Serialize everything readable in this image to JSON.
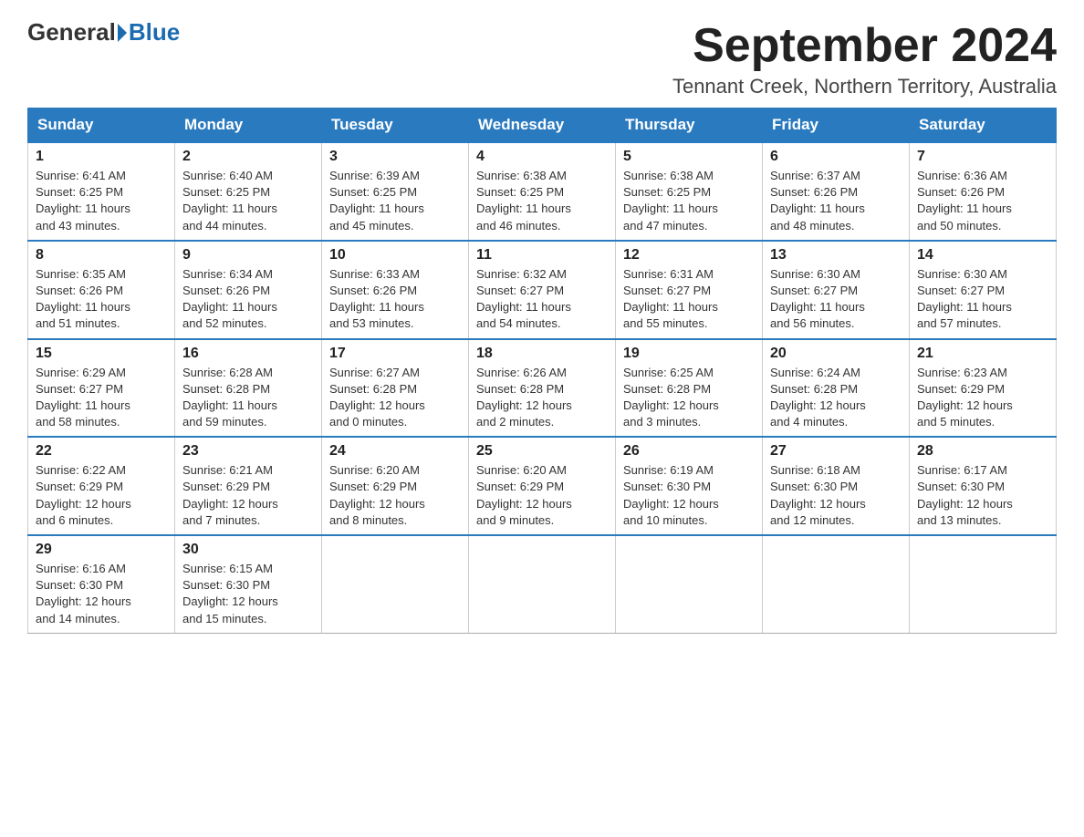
{
  "header": {
    "logo": {
      "general": "General",
      "blue": "Blue",
      "alt": "GeneralBlue logo"
    },
    "title": "September 2024",
    "subtitle": "Tennant Creek, Northern Territory, Australia"
  },
  "days_of_week": [
    "Sunday",
    "Monday",
    "Tuesday",
    "Wednesday",
    "Thursday",
    "Friday",
    "Saturday"
  ],
  "weeks": [
    [
      {
        "day": "1",
        "sunrise": "6:41 AM",
        "sunset": "6:25 PM",
        "daylight": "11 hours and 43 minutes."
      },
      {
        "day": "2",
        "sunrise": "6:40 AM",
        "sunset": "6:25 PM",
        "daylight": "11 hours and 44 minutes."
      },
      {
        "day": "3",
        "sunrise": "6:39 AM",
        "sunset": "6:25 PM",
        "daylight": "11 hours and 45 minutes."
      },
      {
        "day": "4",
        "sunrise": "6:38 AM",
        "sunset": "6:25 PM",
        "daylight": "11 hours and 46 minutes."
      },
      {
        "day": "5",
        "sunrise": "6:38 AM",
        "sunset": "6:25 PM",
        "daylight": "11 hours and 47 minutes."
      },
      {
        "day": "6",
        "sunrise": "6:37 AM",
        "sunset": "6:26 PM",
        "daylight": "11 hours and 48 minutes."
      },
      {
        "day": "7",
        "sunrise": "6:36 AM",
        "sunset": "6:26 PM",
        "daylight": "11 hours and 50 minutes."
      }
    ],
    [
      {
        "day": "8",
        "sunrise": "6:35 AM",
        "sunset": "6:26 PM",
        "daylight": "11 hours and 51 minutes."
      },
      {
        "day": "9",
        "sunrise": "6:34 AM",
        "sunset": "6:26 PM",
        "daylight": "11 hours and 52 minutes."
      },
      {
        "day": "10",
        "sunrise": "6:33 AM",
        "sunset": "6:26 PM",
        "daylight": "11 hours and 53 minutes."
      },
      {
        "day": "11",
        "sunrise": "6:32 AM",
        "sunset": "6:27 PM",
        "daylight": "11 hours and 54 minutes."
      },
      {
        "day": "12",
        "sunrise": "6:31 AM",
        "sunset": "6:27 PM",
        "daylight": "11 hours and 55 minutes."
      },
      {
        "day": "13",
        "sunrise": "6:30 AM",
        "sunset": "6:27 PM",
        "daylight": "11 hours and 56 minutes."
      },
      {
        "day": "14",
        "sunrise": "6:30 AM",
        "sunset": "6:27 PM",
        "daylight": "11 hours and 57 minutes."
      }
    ],
    [
      {
        "day": "15",
        "sunrise": "6:29 AM",
        "sunset": "6:27 PM",
        "daylight": "11 hours and 58 minutes."
      },
      {
        "day": "16",
        "sunrise": "6:28 AM",
        "sunset": "6:28 PM",
        "daylight": "11 hours and 59 minutes."
      },
      {
        "day": "17",
        "sunrise": "6:27 AM",
        "sunset": "6:28 PM",
        "daylight": "12 hours and 0 minutes."
      },
      {
        "day": "18",
        "sunrise": "6:26 AM",
        "sunset": "6:28 PM",
        "daylight": "12 hours and 2 minutes."
      },
      {
        "day": "19",
        "sunrise": "6:25 AM",
        "sunset": "6:28 PM",
        "daylight": "12 hours and 3 minutes."
      },
      {
        "day": "20",
        "sunrise": "6:24 AM",
        "sunset": "6:28 PM",
        "daylight": "12 hours and 4 minutes."
      },
      {
        "day": "21",
        "sunrise": "6:23 AM",
        "sunset": "6:29 PM",
        "daylight": "12 hours and 5 minutes."
      }
    ],
    [
      {
        "day": "22",
        "sunrise": "6:22 AM",
        "sunset": "6:29 PM",
        "daylight": "12 hours and 6 minutes."
      },
      {
        "day": "23",
        "sunrise": "6:21 AM",
        "sunset": "6:29 PM",
        "daylight": "12 hours and 7 minutes."
      },
      {
        "day": "24",
        "sunrise": "6:20 AM",
        "sunset": "6:29 PM",
        "daylight": "12 hours and 8 minutes."
      },
      {
        "day": "25",
        "sunrise": "6:20 AM",
        "sunset": "6:29 PM",
        "daylight": "12 hours and 9 minutes."
      },
      {
        "day": "26",
        "sunrise": "6:19 AM",
        "sunset": "6:30 PM",
        "daylight": "12 hours and 10 minutes."
      },
      {
        "day": "27",
        "sunrise": "6:18 AM",
        "sunset": "6:30 PM",
        "daylight": "12 hours and 12 minutes."
      },
      {
        "day": "28",
        "sunrise": "6:17 AM",
        "sunset": "6:30 PM",
        "daylight": "12 hours and 13 minutes."
      }
    ],
    [
      {
        "day": "29",
        "sunrise": "6:16 AM",
        "sunset": "6:30 PM",
        "daylight": "12 hours and 14 minutes."
      },
      {
        "day": "30",
        "sunrise": "6:15 AM",
        "sunset": "6:30 PM",
        "daylight": "12 hours and 15 minutes."
      },
      null,
      null,
      null,
      null,
      null
    ]
  ],
  "labels": {
    "sunrise": "Sunrise:",
    "sunset": "Sunset:",
    "daylight": "Daylight:"
  }
}
